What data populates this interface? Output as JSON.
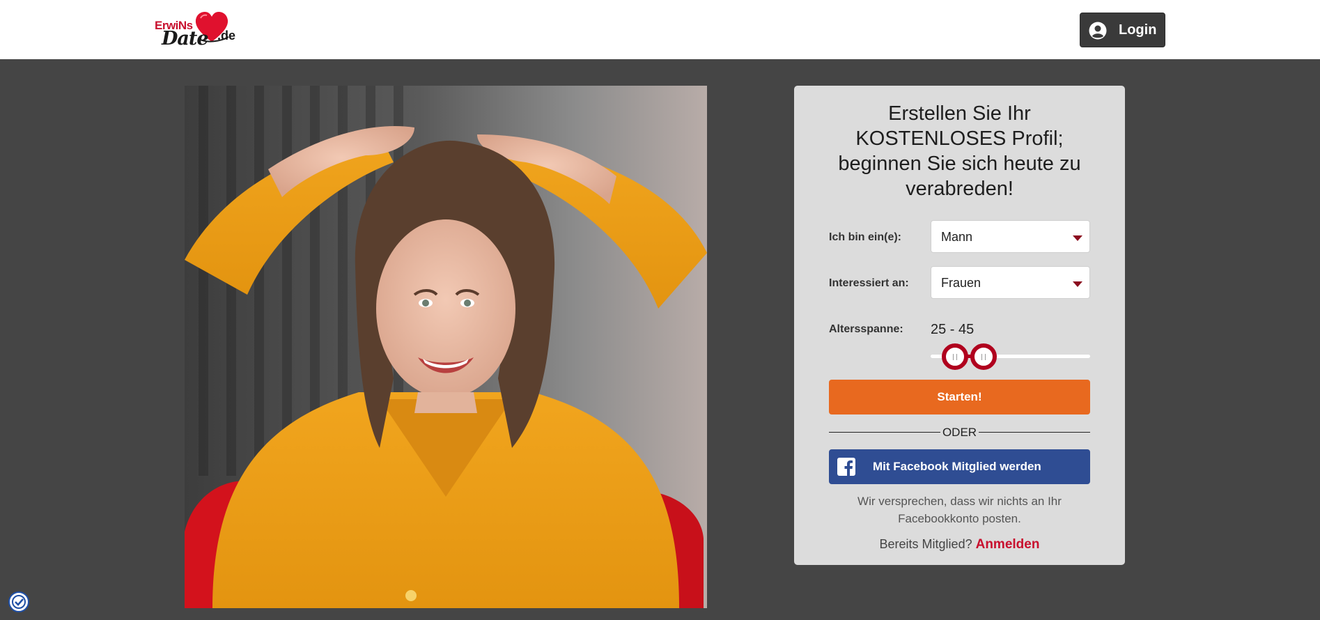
{
  "header": {
    "logo": {
      "line1": "ErwiNs",
      "line2": "Date",
      "tld": ".de"
    },
    "login_label": "Login"
  },
  "signup": {
    "title": "Erstellen Sie Ihr KOSTENLOSES Profil; beginnen Sie sich heute zu verabreden!",
    "gender": {
      "label": "Ich bin ein(e):",
      "value": "Mann"
    },
    "interest": {
      "label": "Interessiert an:",
      "value": "Frauen"
    },
    "age": {
      "label": "Altersspanne:",
      "value_text": "25 - 45",
      "min": 25,
      "max": 45,
      "range_min": 18,
      "range_max": 99
    },
    "start_label": "Starten!",
    "or_label": "ODER",
    "facebook_label": "Mit Facebook Mitglied werden",
    "promise_text": "Wir versprechen, dass wir nichts an Ihr Facebookkonto posten.",
    "already_member": "Bereits Mitglied?",
    "signin_label": "Anmelden"
  },
  "colors": {
    "header_bg": "#ffffff",
    "page_bg": "#454545",
    "card_bg": "#dcdcdc",
    "brand_red": "#c8102e",
    "start_orange": "#e8691f",
    "facebook_blue": "#2f4d93",
    "login_dark": "#3a3a3a"
  },
  "icons": {
    "login": "user-circle-icon",
    "select": "caret-down-icon",
    "facebook": "facebook-icon",
    "badge": "check-shield-icon",
    "logo": "heart-icon"
  }
}
